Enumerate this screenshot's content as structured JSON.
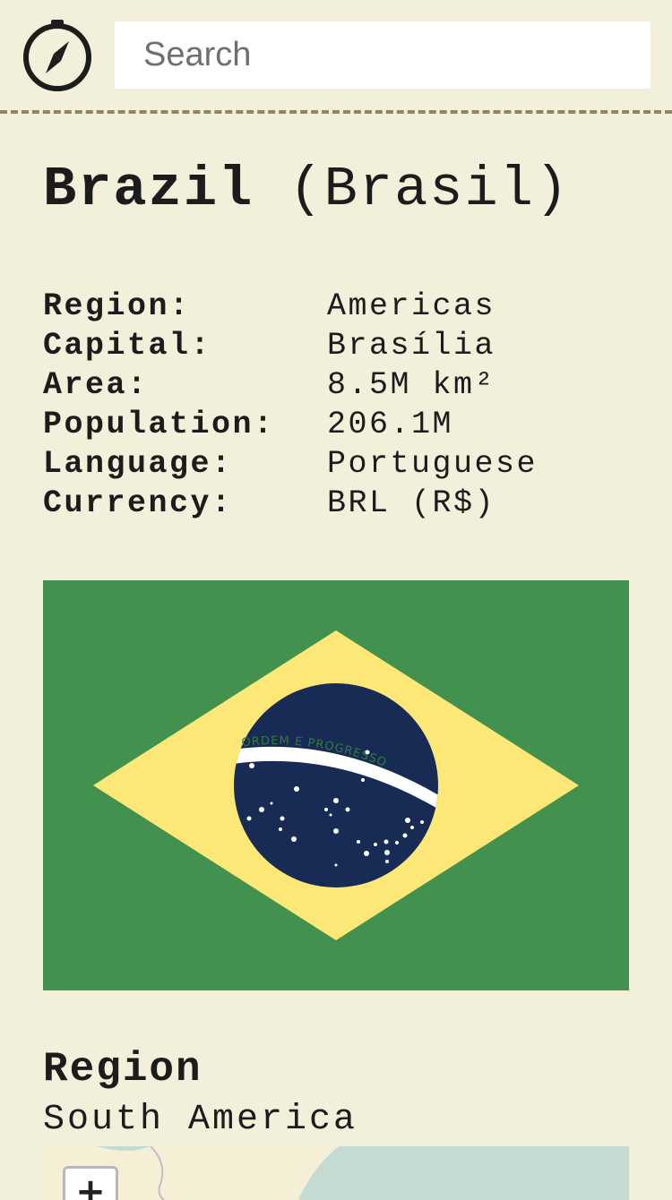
{
  "header": {
    "logo_icon": "compass-icon",
    "search_placeholder": "Search"
  },
  "country": {
    "name": "Brazil",
    "native_name": "(Brasil)"
  },
  "facts": [
    {
      "label": "Region:",
      "value": "Americas"
    },
    {
      "label": "Capital:",
      "value": "Brasília"
    },
    {
      "label": "Area:",
      "value": "8.5M km²"
    },
    {
      "label": "Population:",
      "value": "206.1M"
    },
    {
      "label": "Language:",
      "value": "Portuguese"
    },
    {
      "label": "Currency:",
      "value": "BRL (R$)"
    }
  ],
  "flag": {
    "motto": "ORDEM E PROGRESSO",
    "colors": {
      "green": "#43914e",
      "yellow": "#fde877",
      "blue": "#182b54",
      "white": "#ffffff"
    }
  },
  "region_section": {
    "heading": "Region",
    "value": "South America"
  },
  "map": {
    "zoom_in_label": "+",
    "colors": {
      "water": "#c4dbd4",
      "land": "#f5efd5"
    }
  },
  "theme": {
    "background": "#f2efdb",
    "divider": "#8f8565"
  }
}
